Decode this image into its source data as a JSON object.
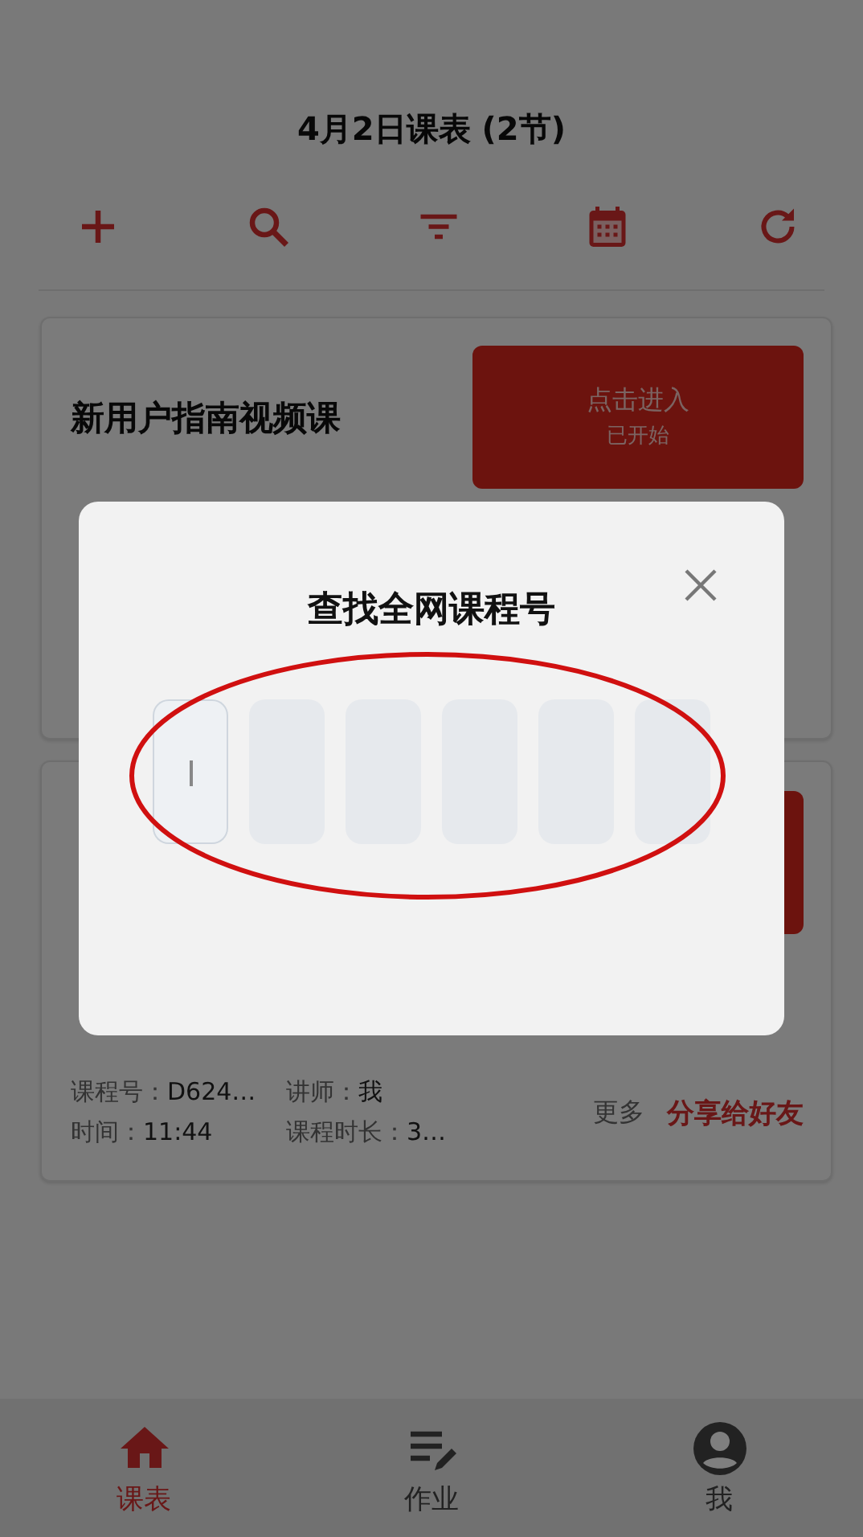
{
  "header": {
    "title": "4月2日课表 (2节)"
  },
  "toolbar": [
    {
      "kind": "add"
    },
    {
      "kind": "search"
    },
    {
      "kind": "filter"
    },
    {
      "kind": "calendar"
    },
    {
      "kind": "refresh"
    }
  ],
  "courses": [
    {
      "title": "新用户指南视频课",
      "enter_button": {
        "label": "点击进入",
        "status": "已开始"
      }
    },
    {
      "info": [
        {
          "label": "课程号：",
          "value": "D624…"
        },
        {
          "label": "讲师：",
          "value": "我"
        },
        {
          "label": "时间：",
          "value": "11:44"
        },
        {
          "label": "课程时长：",
          "value": "3…"
        }
      ],
      "more": "更多",
      "share_link": "分享给好友"
    }
  ],
  "dialog": {
    "title": "查找全网课程号",
    "code_boxes": [
      {
        "focused": true
      },
      {
        "focused": false
      },
      {
        "focused": false
      },
      {
        "focused": false
      },
      {
        "focused": false
      },
      {
        "focused": false
      }
    ],
    "annotation": {
      "kind": "ellipse"
    }
  },
  "bottom_nav": [
    {
      "label": "课表",
      "kind": "home",
      "selected": true
    },
    {
      "label": "作业",
      "kind": "edit-list",
      "selected": false
    },
    {
      "label": "我",
      "kind": "person",
      "selected": false
    }
  ]
}
